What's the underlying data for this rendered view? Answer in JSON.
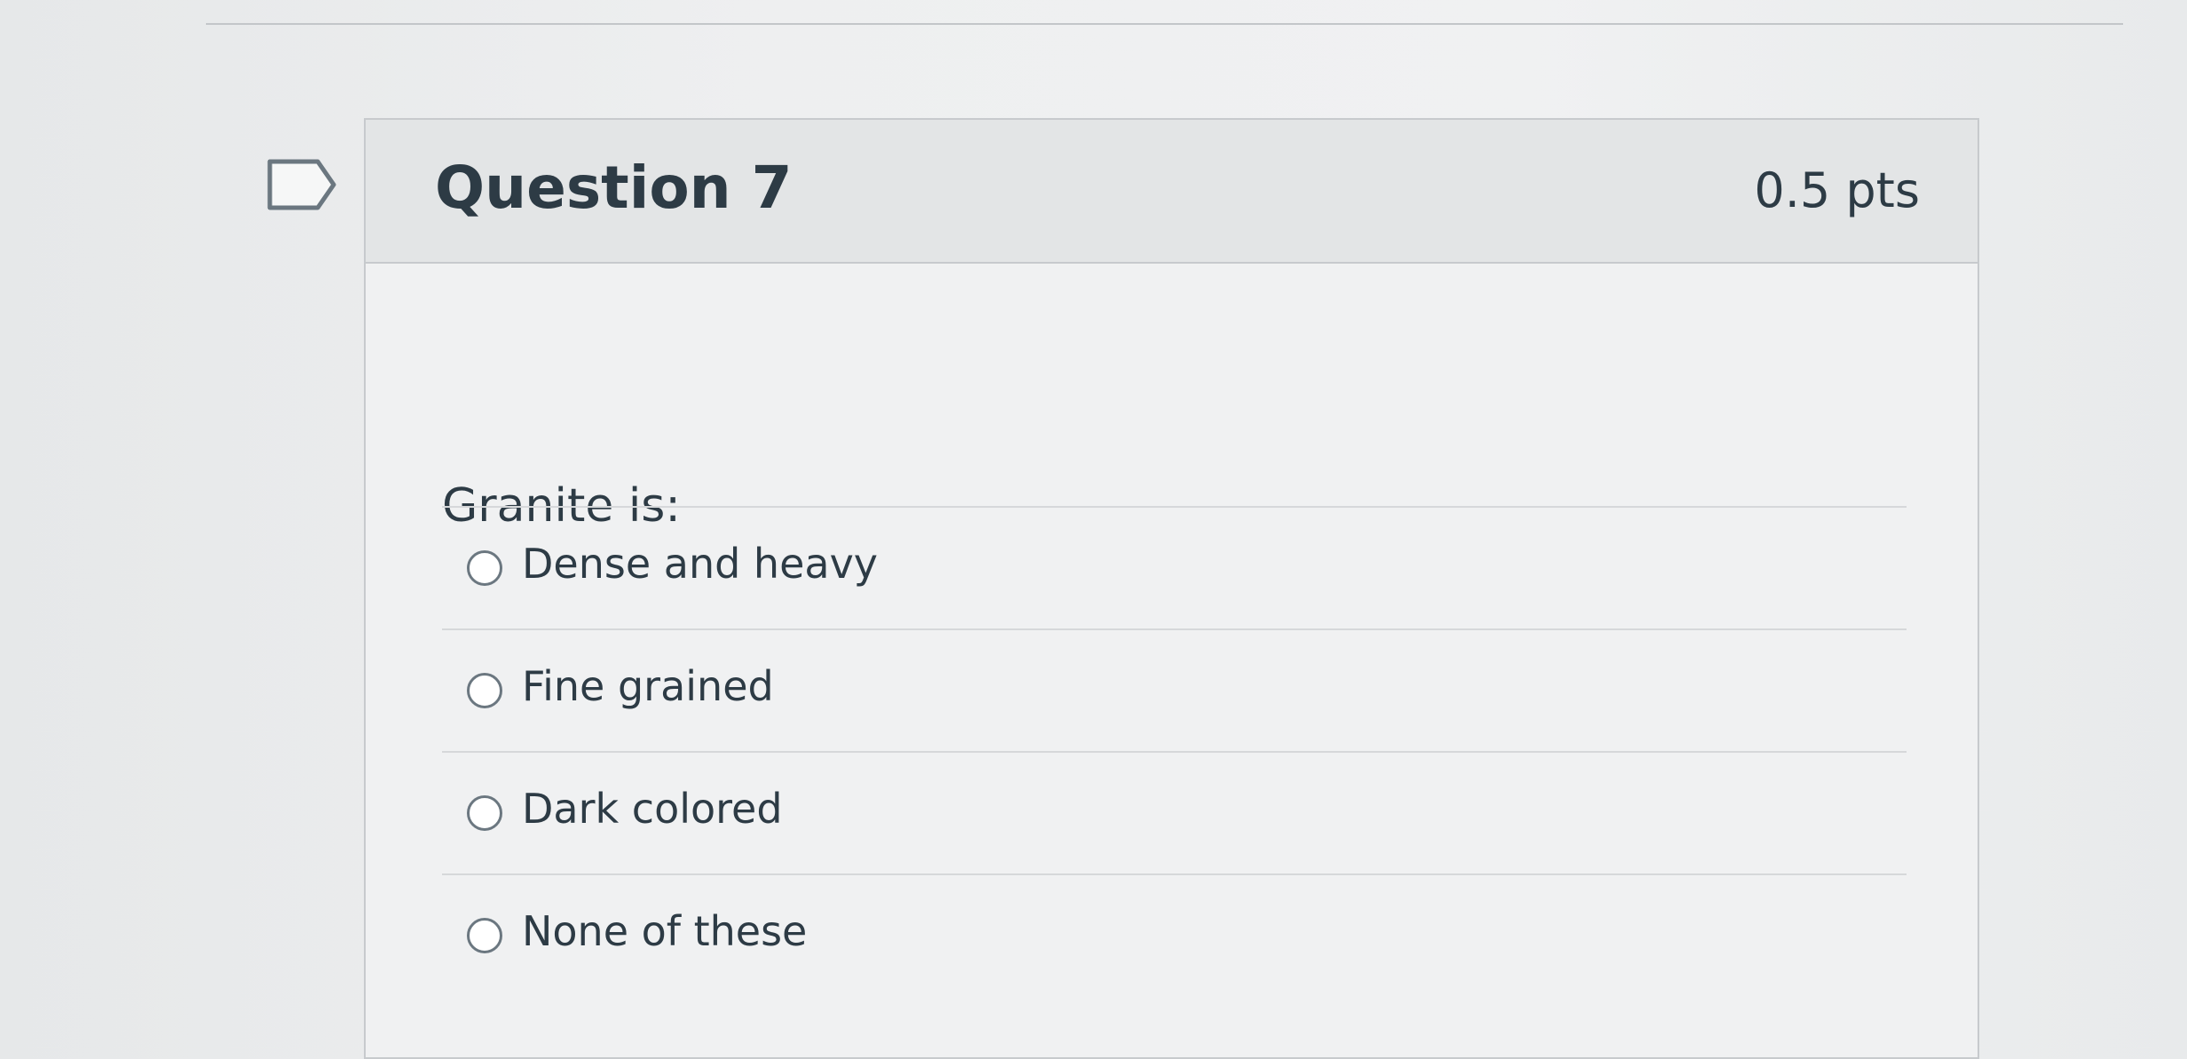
{
  "question": {
    "title": "Question 7",
    "points": "0.5 pts",
    "prompt": "Granite is:",
    "flag_icon": "flag-outline-icon",
    "answers": [
      {
        "label": "Dense and heavy"
      },
      {
        "label": "Fine grained"
      },
      {
        "label": "Dark colored"
      },
      {
        "label": "None of these"
      }
    ]
  },
  "colors": {
    "text": "#2d3b45",
    "header_bg": "#e3e5e6",
    "border": "#c7cacd"
  }
}
